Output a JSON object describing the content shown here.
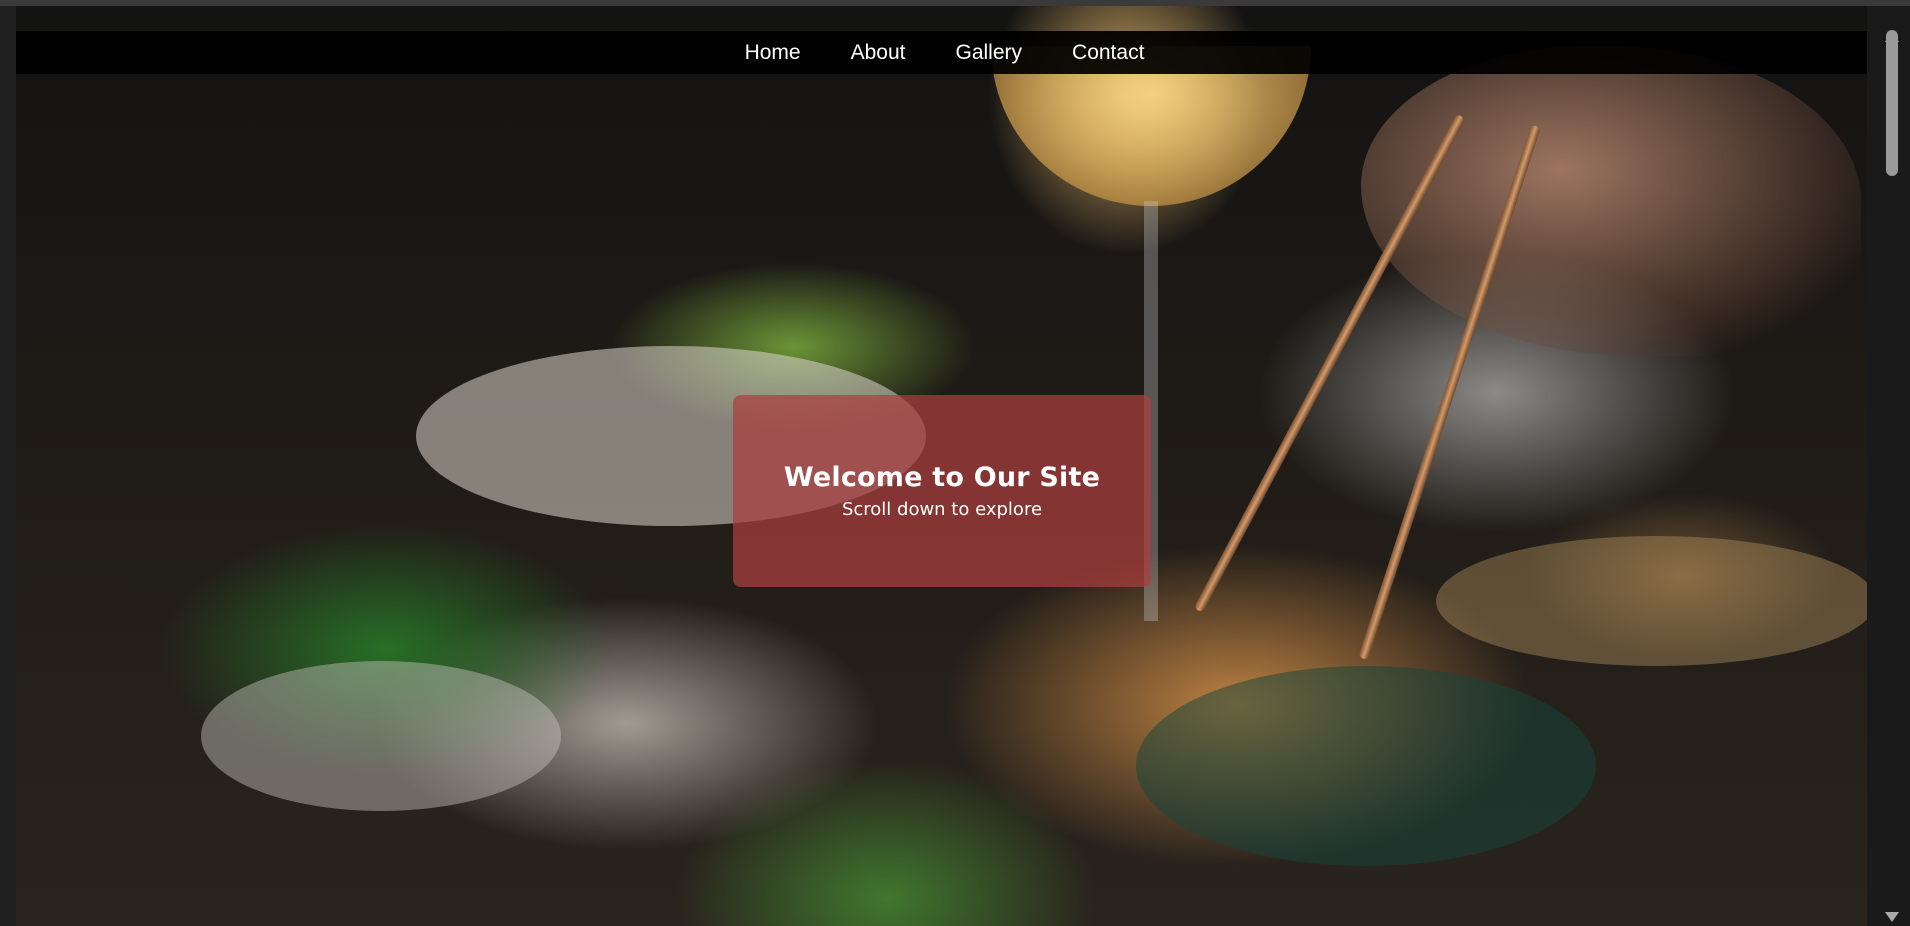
{
  "nav": {
    "items": [
      {
        "label": "Home"
      },
      {
        "label": "About"
      },
      {
        "label": "Gallery"
      },
      {
        "label": "Contact"
      }
    ]
  },
  "hero": {
    "title": "Welcome to Our Site",
    "subtitle": "Scroll down to explore",
    "card_color": "#aa3e3e",
    "navbar_color": "#000000"
  },
  "scrollbar": {
    "position": 0.0
  }
}
